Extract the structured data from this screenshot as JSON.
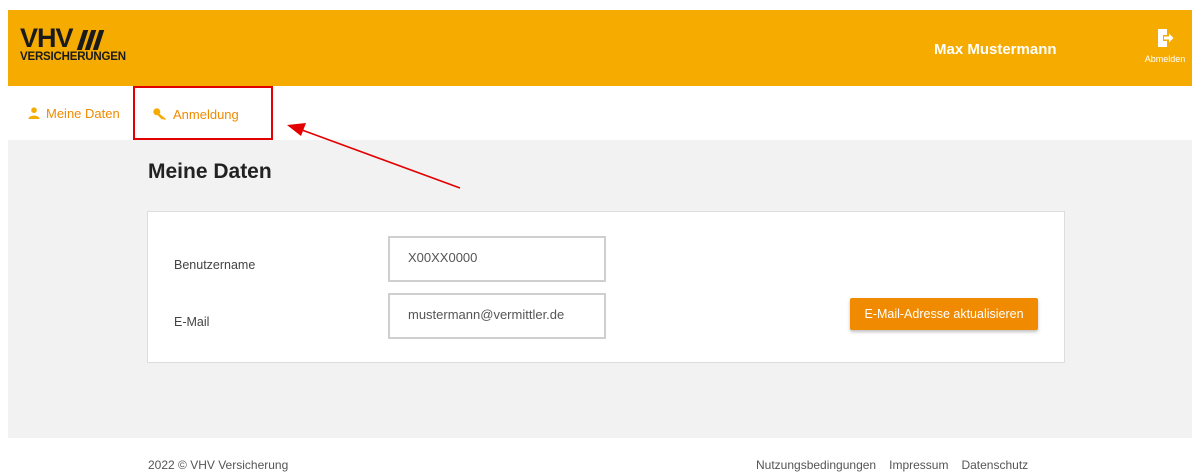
{
  "brand": {
    "name": "VHV",
    "subtitle": "VERSICHERUNGEN"
  },
  "header": {
    "user_name": "Max Mustermann",
    "logout_label": "Abmelden"
  },
  "nav": {
    "items": [
      {
        "label": "Meine Daten",
        "icon": "person-icon"
      },
      {
        "label": "Anmeldung",
        "icon": "key-icon"
      }
    ]
  },
  "main": {
    "title": "Meine Daten",
    "username_label": "Benutzername",
    "username_value": "X00XX0000",
    "email_label": "E-Mail",
    "email_value": "mustermann@vermittler.de",
    "update_button": "E-Mail-Adresse aktualisieren"
  },
  "footer": {
    "copyright": "2022 © VHV Versicherung",
    "links": [
      "Nutzungsbedingungen",
      "Impressum",
      "Datenschutz"
    ]
  },
  "colors": {
    "brand_yellow": "#f5ab00",
    "accent_orange": "#f08a00",
    "annotation_red": "#e30000"
  }
}
